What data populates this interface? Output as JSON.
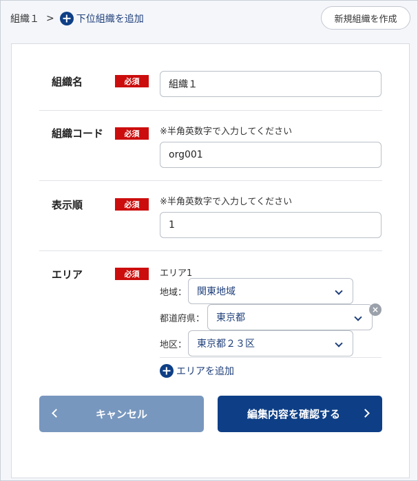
{
  "breadcrumb": {
    "current": "組織１",
    "separator": ">",
    "add_child_label": "下位組織を追加"
  },
  "header": {
    "new_org_label": "新規組織を作成"
  },
  "form": {
    "required_badge": "必須",
    "org_name": {
      "label": "組織名",
      "value": "組織１"
    },
    "org_code": {
      "label": "組織コード",
      "note": "※半角英数字で入力してください",
      "value": "org001"
    },
    "display_order": {
      "label": "表示順",
      "note": "※半角英数字で入力してください",
      "value": "1"
    },
    "area": {
      "label": "エリア",
      "title": "エリア1",
      "region_label": "地域：",
      "region_value": "関東地域",
      "prefecture_label": "都道府県：",
      "prefecture_value": "東京都",
      "district_label": "地区：",
      "district_value": "東京都２３区",
      "remove_icon": "×",
      "add_label": "エリアを追加"
    }
  },
  "buttons": {
    "cancel_label": "キャンセル",
    "confirm_label": "編集内容を確認する"
  },
  "colors": {
    "primary": "#0e3f86",
    "cancel": "#7897be",
    "required": "#cc0d0d"
  }
}
